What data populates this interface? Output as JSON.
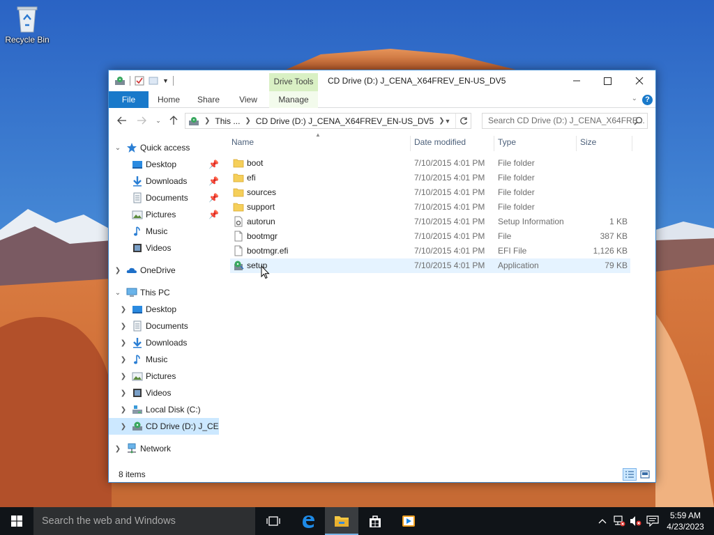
{
  "desktop": {
    "recycle_bin_label": "Recycle Bin"
  },
  "window": {
    "title": "CD Drive (D:) J_CENA_X64FREV_EN-US_DV5",
    "contextual_tab_group": "Drive Tools",
    "ribbon_tabs": [
      {
        "label": "File"
      },
      {
        "label": "Home"
      },
      {
        "label": "Share"
      },
      {
        "label": "View"
      },
      {
        "label": "Manage"
      }
    ],
    "help_label": "?",
    "address": {
      "segments": [
        "This ...",
        "CD Drive (D:) J_CENA_X64FREV_EN-US_DV5"
      ]
    },
    "search": {
      "placeholder": "Search CD Drive (D:) J_CENA_X64FRE..."
    },
    "nav_pane": {
      "quick_access": {
        "label": "Quick access",
        "items": [
          {
            "label": "Desktop",
            "pinned": true
          },
          {
            "label": "Downloads",
            "pinned": true
          },
          {
            "label": "Documents",
            "pinned": true
          },
          {
            "label": "Pictures",
            "pinned": true
          },
          {
            "label": "Music",
            "pinned": false
          },
          {
            "label": "Videos",
            "pinned": false
          }
        ]
      },
      "onedrive": {
        "label": "OneDrive"
      },
      "this_pc": {
        "label": "This PC",
        "items": [
          {
            "label": "Desktop"
          },
          {
            "label": "Documents"
          },
          {
            "label": "Downloads"
          },
          {
            "label": "Music"
          },
          {
            "label": "Pictures"
          },
          {
            "label": "Videos"
          },
          {
            "label": "Local Disk (C:)"
          },
          {
            "label": "CD Drive (D:) J_CEN"
          }
        ]
      },
      "network": {
        "label": "Network"
      }
    },
    "columns": {
      "name": "Name",
      "date": "Date modified",
      "type": "Type",
      "size": "Size"
    },
    "files": [
      {
        "name": "boot",
        "date": "7/10/2015 4:01 PM",
        "type": "File folder",
        "size": "",
        "icon": "folder-icon"
      },
      {
        "name": "efi",
        "date": "7/10/2015 4:01 PM",
        "type": "File folder",
        "size": "",
        "icon": "folder-icon"
      },
      {
        "name": "sources",
        "date": "7/10/2015 4:01 PM",
        "type": "File folder",
        "size": "",
        "icon": "folder-icon"
      },
      {
        "name": "support",
        "date": "7/10/2015 4:01 PM",
        "type": "File folder",
        "size": "",
        "icon": "folder-icon"
      },
      {
        "name": "autorun",
        "date": "7/10/2015 4:01 PM",
        "type": "Setup Information",
        "size": "1 KB",
        "icon": "settings-file-icon"
      },
      {
        "name": "bootmgr",
        "date": "7/10/2015 4:01 PM",
        "type": "File",
        "size": "387 KB",
        "icon": "file-icon"
      },
      {
        "name": "bootmgr.efi",
        "date": "7/10/2015 4:01 PM",
        "type": "EFI File",
        "size": "1,126 KB",
        "icon": "file-icon"
      },
      {
        "name": "setup",
        "date": "7/10/2015 4:01 PM",
        "type": "Application",
        "size": "79 KB",
        "icon": "setup-app-icon"
      }
    ],
    "status": {
      "item_count": "8 items"
    }
  },
  "taskbar": {
    "search_placeholder": "Search the web and Windows",
    "clock": {
      "time": "5:59 AM",
      "date": "4/23/2023"
    }
  },
  "colors": {
    "accent": "#1979ca",
    "selection": "#cce8ff",
    "hover": "#e5f3ff",
    "drive_tools": "#d9f0c4",
    "taskbar": "#101418"
  }
}
